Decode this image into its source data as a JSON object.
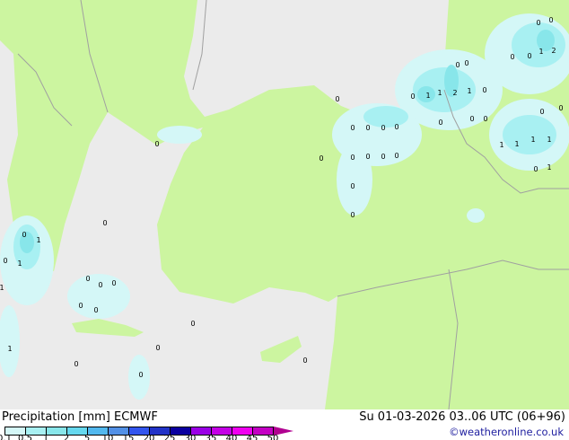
{
  "header": {
    "title": "Precipitation [mm]  ECMWF",
    "valid_time": "Su 01-03-2026 03..06 UTC (06+96)",
    "credit": "©weatheronline.co.uk"
  },
  "colors": {
    "sea": "#ebebeb",
    "land": "#ccf5a0",
    "border": "#a0a0a0"
  },
  "legend": {
    "ticks": [
      "0.1",
      "0.5",
      "1",
      "2",
      "5",
      "10",
      "15",
      "20",
      "25",
      "30",
      "35",
      "40",
      "45",
      "50"
    ],
    "swatches": [
      "#d4f7f7",
      "#a8f0f2",
      "#88e6ea",
      "#66d8ee",
      "#52b8ee",
      "#5290e6",
      "#3355ee",
      "#2233c8",
      "#0a00a0",
      "#9a00e6",
      "#c400e6",
      "#f000f0",
      "#c400c4"
    ],
    "overflow_color": "#b00090"
  },
  "map_labels": [
    "0",
    "0",
    "0",
    "0",
    "1",
    "2",
    "0",
    "0",
    "1",
    "0",
    "1",
    "2",
    "1",
    "0",
    "0",
    "0",
    "0",
    "0",
    "0",
    "0",
    "0",
    "0",
    "0",
    "1",
    "1",
    "1",
    "1",
    "0",
    "0",
    "0",
    "0",
    "0",
    "0",
    "0",
    "0",
    "0",
    "0",
    "0",
    "1",
    "0",
    "1",
    "1",
    "0",
    "0",
    "0",
    "0",
    "0",
    "0",
    "1",
    "0",
    "0",
    "0",
    "0",
    "0",
    "1"
  ]
}
